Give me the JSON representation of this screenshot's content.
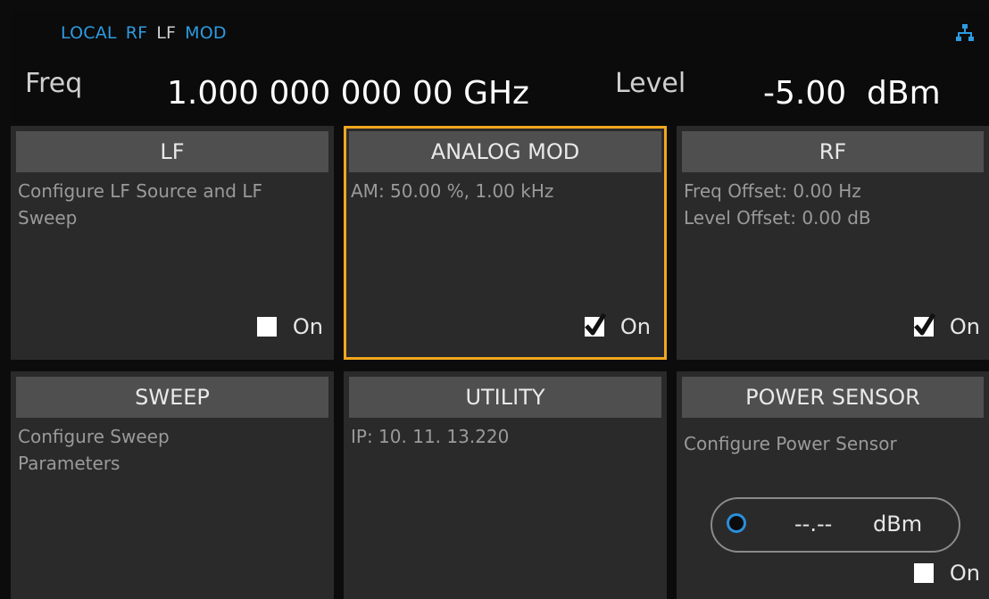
{
  "status_bar": {
    "local": "LOCAL",
    "rf": "RF",
    "lf": "LF",
    "mod": "MOD"
  },
  "frequency": {
    "label": "Freq",
    "value": "1.000 000 000 00",
    "unit": "GHz"
  },
  "level": {
    "label": "Level",
    "value": "-5.00",
    "unit": "dBm"
  },
  "tiles": {
    "lf": {
      "title": "LF",
      "lines": [
        "Configure LF Source and LF",
        "Sweep"
      ],
      "checkbox_label": "On",
      "checked": false
    },
    "analog_mod": {
      "title": "ANALOG MOD",
      "lines": [
        "AM: 50.00 %, 1.00 kHz"
      ],
      "checkbox_label": "On",
      "checked": true
    },
    "rf": {
      "title": "RF",
      "lines": [
        "Freq Offset: 0.00 Hz",
        "Level Offset: 0.00 dB"
      ],
      "checkbox_label": "On",
      "checked": true
    },
    "sweep": {
      "title": "SWEEP",
      "lines": [
        "Configure Sweep",
        "Parameters"
      ]
    },
    "utility": {
      "title": "UTILITY",
      "lines": [
        "IP:  10. 11. 13.220"
      ]
    },
    "power_sensor": {
      "title": "POWER SENSOR",
      "lines": [
        "Configure Power Sensor"
      ],
      "reading_value": "--.--",
      "reading_unit": "dBm",
      "checkbox_label": "On",
      "checked": false
    }
  },
  "colors": {
    "accent_blue": "#2d9be0",
    "selection_orange": "#f0a81e",
    "tile_bg": "#2a2a2a",
    "tile_header_bg": "#4f4f4f"
  },
  "icons": {
    "network": "network-icon",
    "check": "check-icon"
  }
}
